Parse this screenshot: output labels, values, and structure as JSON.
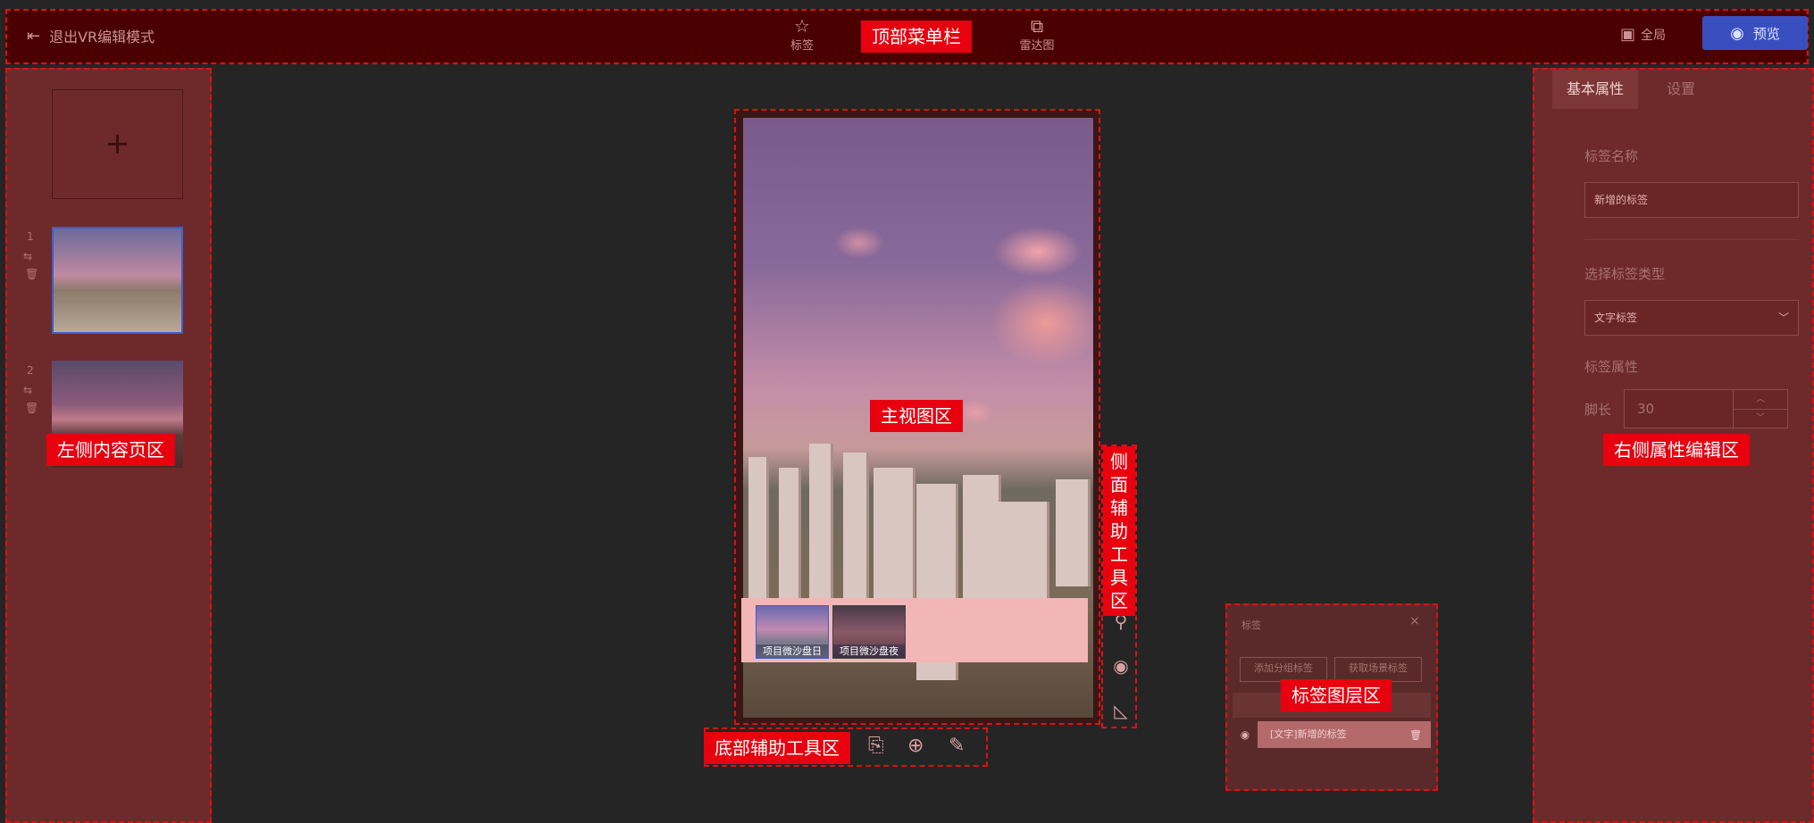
{
  "top_bar": {
    "exit_label": "退出VR编辑模式",
    "menu": [
      {
        "label": "标签",
        "icon": "star-icon"
      },
      {
        "label": "雷达图",
        "icon": "radar-map-icon"
      }
    ],
    "fullscreen_label": "全局",
    "preview_label": "预览"
  },
  "left_panel": {
    "add_symbol": "+",
    "pages": [
      {
        "index": "1"
      },
      {
        "index": "2"
      }
    ]
  },
  "viewer": {
    "scenes": [
      {
        "label": "项目微沙盘日"
      },
      {
        "label": "项目微沙盘夜"
      }
    ]
  },
  "layer_panel": {
    "title": "标签",
    "close_symbol": "×",
    "add_group_label": "添加分组标签",
    "get_scene_label": "获取场景标签",
    "item_label": "[文字]新增的标签"
  },
  "right_panel": {
    "tabs": [
      "基本属性",
      "设置"
    ],
    "name_label": "标签名称",
    "name_value": "新增的标签",
    "type_label": "选择标签类型",
    "type_value": "文字标签",
    "attr_label": "标签属性",
    "foot_label": "脚长",
    "foot_value": "30"
  },
  "overlay_tags": {
    "top_menu": "顶部菜单栏",
    "left_content": "左侧内容页区",
    "main_view": "主视图区",
    "side_tools": "侧面辅助工具区",
    "tag_layer": "标签图层区",
    "bottom_tools": "底部辅助工具区",
    "right_props": "右侧属性编辑区"
  },
  "colors": {
    "overlay_red": "#e8000f",
    "preview_button": "#3a4fbf"
  }
}
